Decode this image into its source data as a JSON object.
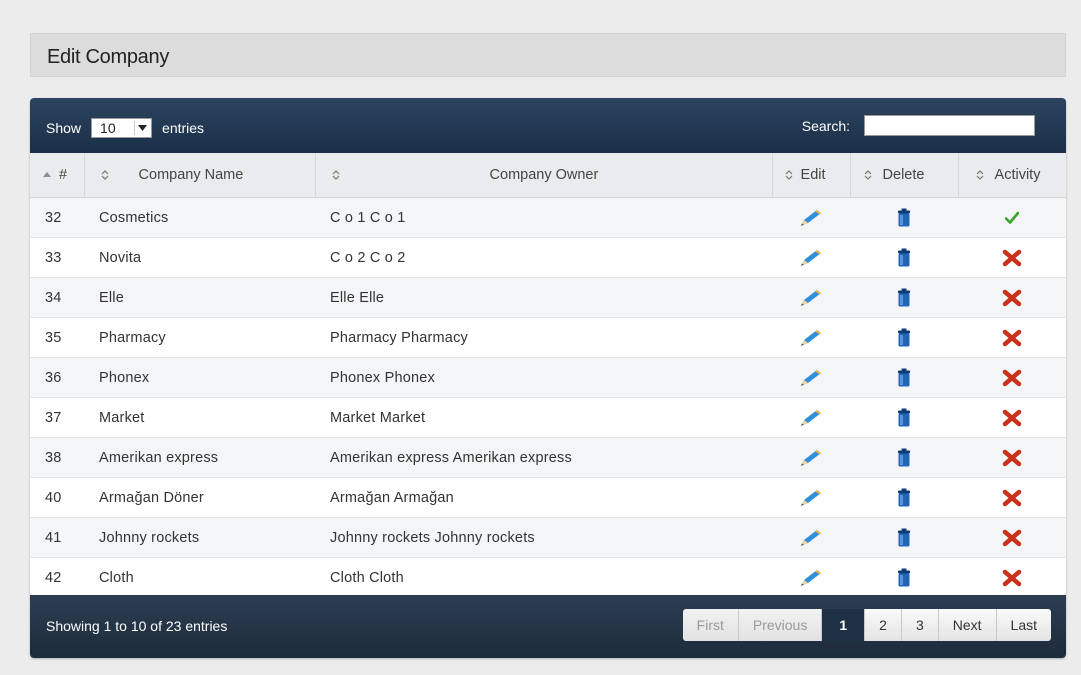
{
  "page": {
    "title": "Edit Company"
  },
  "controls": {
    "show_label": "Show",
    "page_length": "10",
    "entries_label": "entries",
    "search_label": "Search:",
    "search_value": ""
  },
  "table": {
    "headers": {
      "id": "#",
      "name": "Company Name",
      "owner": "Company Owner",
      "edit": "Edit",
      "delete": "Delete",
      "activity": "Activity"
    },
    "rows": [
      {
        "id": "32",
        "name": "Cosmetics",
        "owner": "C o 1 C o 1",
        "active": true
      },
      {
        "id": "33",
        "name": "Novita",
        "owner": "C o 2 C o 2",
        "active": false
      },
      {
        "id": "34",
        "name": "Elle",
        "owner": "Elle Elle",
        "active": false
      },
      {
        "id": "35",
        "name": "Pharmacy",
        "owner": "Pharmacy Pharmacy",
        "active": false
      },
      {
        "id": "36",
        "name": "Phonex",
        "owner": "Phonex Phonex",
        "active": false
      },
      {
        "id": "37",
        "name": "Market",
        "owner": "Market Market",
        "active": false
      },
      {
        "id": "38",
        "name": "Amerikan express",
        "owner": "Amerikan express Amerikan express",
        "active": false
      },
      {
        "id": "40",
        "name": "Armağan Döner",
        "owner": "Armağan Armağan",
        "active": false
      },
      {
        "id": "41",
        "name": "Johnny rockets",
        "owner": "Johnny rockets Johnny rockets",
        "active": false
      },
      {
        "id": "42",
        "name": "Cloth",
        "owner": "Cloth Cloth",
        "active": false
      }
    ]
  },
  "footer": {
    "info": "Showing 1 to 10 of 23 entries",
    "pagination": {
      "first": "First",
      "previous": "Previous",
      "pages": [
        "1",
        "2",
        "3"
      ],
      "current": "1",
      "next": "Next",
      "last": "Last"
    }
  },
  "icons": {
    "edit": "pencil-icon",
    "delete": "trash-can-icon",
    "active": "check-icon",
    "inactive": "cross-icon",
    "sort": "sort-arrows-icon"
  },
  "colors": {
    "header_bar": "#1e3046",
    "check": "#3aa32a",
    "cross": "#c8321a",
    "trash": "#1f64b5",
    "pencil": "#2f8fd8"
  }
}
